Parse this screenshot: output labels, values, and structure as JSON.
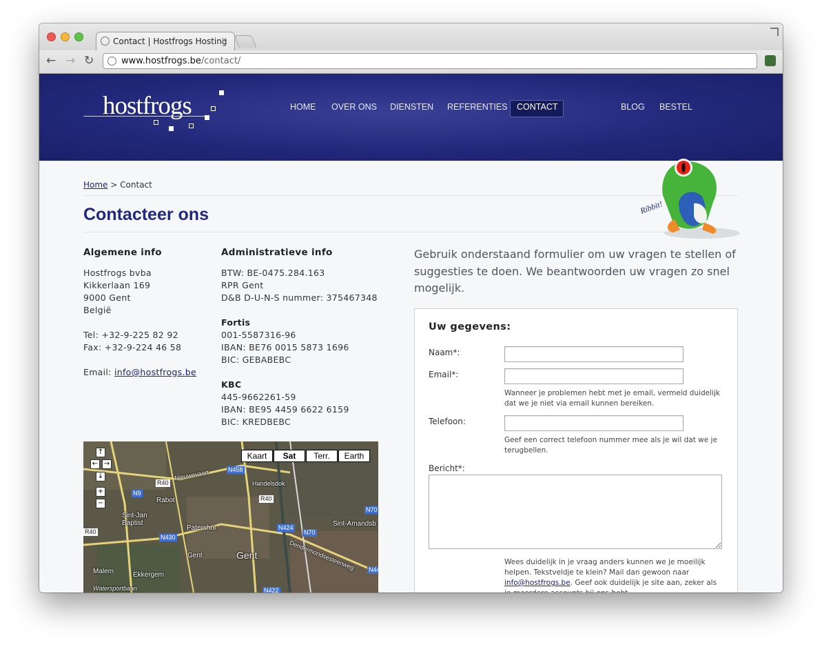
{
  "browser": {
    "tab_title": "Contact | Hostfrogs Hosting",
    "tab_close": "×",
    "url_host": "www.hostfrogs.be",
    "url_path": "/contact/",
    "back": "←",
    "forward": "→",
    "reload": "↻"
  },
  "site": {
    "logo": "hostfrogs",
    "nav": [
      "HOME",
      "OVER ONS",
      "DIENSTEN",
      "REFERENTIES",
      "CONTACT",
      "BLOG",
      "BESTEL"
    ]
  },
  "breadcrumb": {
    "home": "Home",
    "separator": ">",
    "current": "Contact"
  },
  "page_title": "Contacteer ons",
  "frog_label": "Ribbit!",
  "general": {
    "title": "Algemene info",
    "company": "Hostfrogs bvba",
    "street": "Kikkerlaan 169",
    "city": "9000 Gent",
    "country": "België",
    "tel": "Tel: +32-9-225 82 92",
    "fax": "Fax: +32-9-224 46 58",
    "email_label": "Email:",
    "email": "info@hostfrogs.be"
  },
  "admin": {
    "title": "Administratieve info",
    "btw": "BTW: BE-0475.284.163",
    "rpr": "RPR Gent",
    "duns": "D&B D-U-N-S nummer: 375467348",
    "fortis_title": "Fortis",
    "fortis_account": "001-5587316-96",
    "fortis_iban": "IBAN: BE76 0015 5873 1696",
    "fortis_bic": "BIC: GEBABEBC",
    "kbc_title": "KBC",
    "kbc_account": "445-9662261-59",
    "kbc_iban": "IBAN: BE95 4459 6622 6159",
    "kbc_bic": "BIC: KREDBEBC"
  },
  "map": {
    "types": [
      "Kaart",
      "Sat",
      "Terr.",
      "Earth"
    ],
    "controls": {
      "up": "↑",
      "left": "←",
      "right": "→",
      "down": "↓",
      "zoom_in": "+",
      "zoom_out": "−"
    },
    "labels": [
      "Rabot",
      "Sint-Jan Baptist",
      "Patershol",
      "Gent",
      "Gent",
      "Malem",
      "Ekkergem",
      "Sint-Amandsb",
      "Handelsdok",
      "Nieuwevaart",
      "Dendermondsesteenweg",
      "Watersportbaan"
    ],
    "roads": [
      "N458",
      "R40",
      "N9",
      "N430",
      "R40",
      "N424",
      "N70",
      "N70",
      "R40",
      "N422",
      "N44"
    ]
  },
  "form": {
    "intro": "Gebruik onderstaand formulier om uw vragen te stellen of suggesties te doen. We beantwoorden uw vragen zo snel mogelijk.",
    "heading": "Uw gegevens:",
    "name_label": "Naam*:",
    "email_label": "Email*:",
    "email_hint": "Wanneer je problemen hebt met je email, vermeld duidelijk dat we je niet via email kunnen bereiken.",
    "phone_label": "Telefoon:",
    "phone_hint": "Geef een correct telefoon nummer mee als je wil dat we je terugbellen.",
    "message_label": "Bericht*:",
    "message_hint_1": "Wees duidelijk in je vraag anders kunnen we je moeilijk helpen. Tekstveldje te klein? Mail dan gewoon naar",
    "message_hint_email": "info@hostfrogs.be",
    "message_hint_2": ". Geef ook duidelijk je site aan, zeker als je meerdere accounts bij ons hebt."
  }
}
